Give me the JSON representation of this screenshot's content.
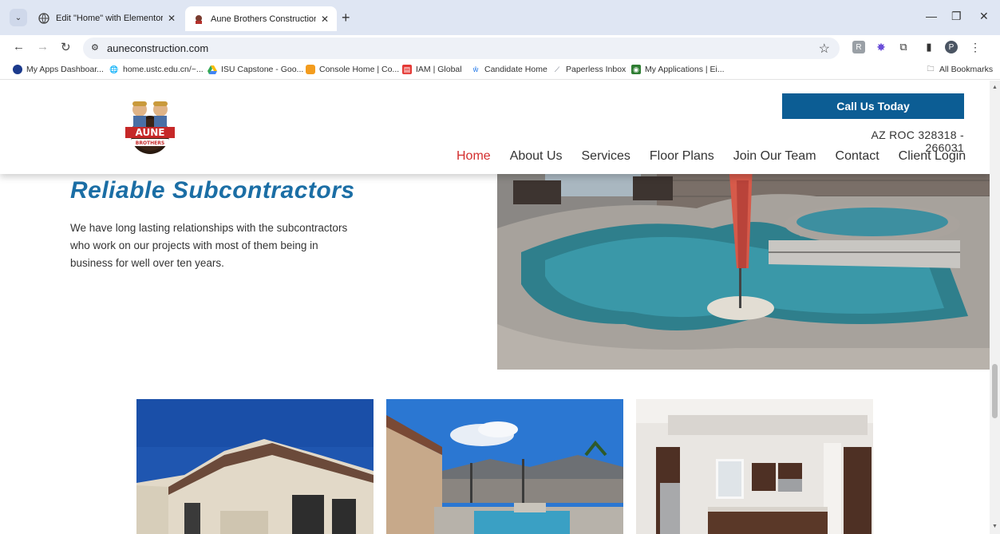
{
  "browser": {
    "tabs": [
      {
        "title": "Edit \"Home\" with Elementor",
        "active": false
      },
      {
        "title": "Aune Brothers Construction",
        "active": true
      }
    ],
    "url": "auneconstruction.com",
    "profile_initial": "P",
    "bookmarks": [
      "My Apps Dashboar...",
      "home.ustc.edu.cn/~...",
      "ISU Capstone - Goo...",
      "Console Home | Co...",
      "IAM | Global",
      "Candidate Home",
      "Paperless Inbox",
      "My Applications | Ei..."
    ],
    "all_bookmarks": "All Bookmarks"
  },
  "header": {
    "logo_text": "AUNE",
    "logo_subtext": "BROTHERS",
    "call_button": "Call Us Today",
    "roc": "AZ ROC 328318 - 266031",
    "nav": [
      "Home",
      "About Us",
      "Services",
      "Floor Plans",
      "Join Our Team",
      "Contact",
      "Client Login"
    ],
    "nav_active": "Home"
  },
  "section": {
    "title": "Reliable Subcontractors",
    "body": "We have long lasting relationships with the subcontractors who work on our projects with most of them being in business for well over ten years."
  },
  "colors": {
    "brand_blue": "#0c5d94",
    "title_blue": "#1b6ea5",
    "nav_active_red": "#d32e2e"
  }
}
